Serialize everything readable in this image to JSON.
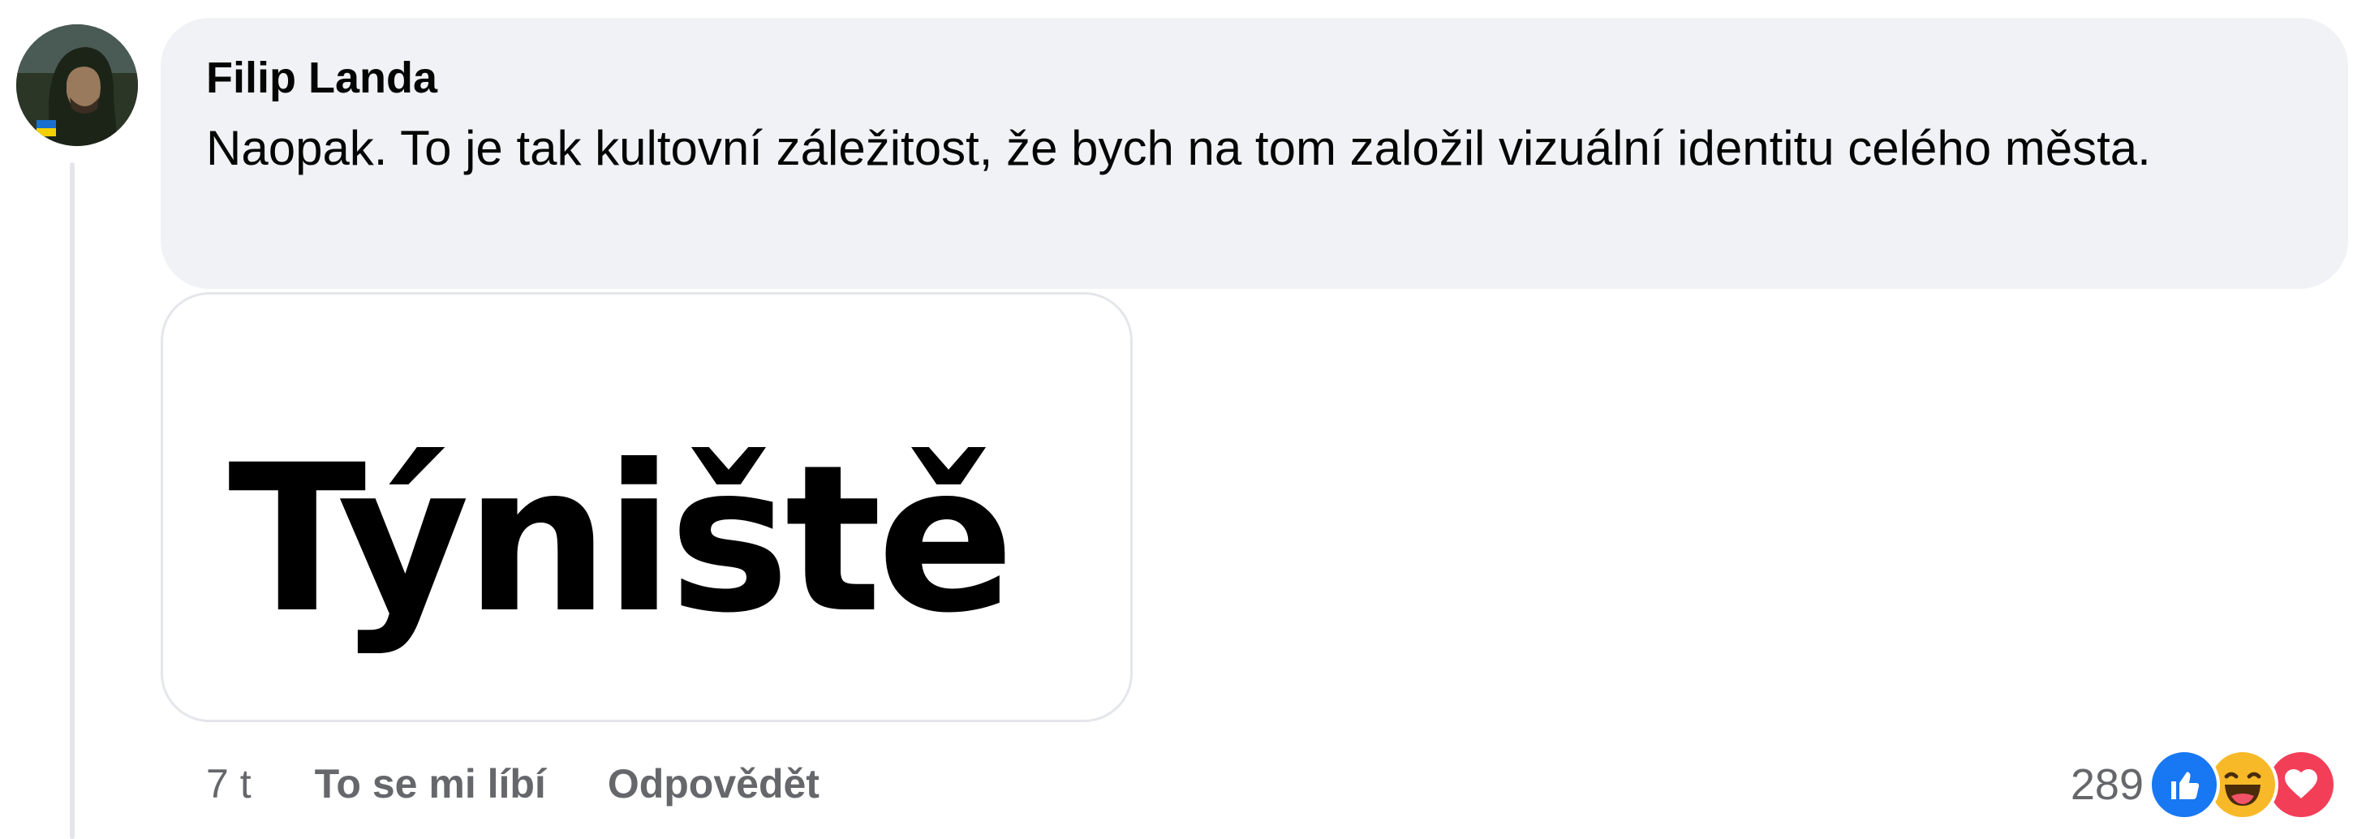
{
  "comment": {
    "author": "Filip Landa",
    "text": "Naopak. To je tak kultovní záležitost, že bych na tom založil vizuální identitu celého města.",
    "attachment": {
      "logo_text": "Týniště"
    }
  },
  "actions": {
    "time": "7 t",
    "like_label": "To se mi líbí",
    "reply_label": "Odpovědět"
  },
  "reactions": {
    "count": "289",
    "icons": [
      "like-icon",
      "haha-icon",
      "love-icon"
    ],
    "colors": {
      "like": "#1877f2",
      "haha": "#f7b928",
      "love": "#f33e58"
    }
  },
  "colors": {
    "bubble": "#f0f2f5",
    "secondary_text": "#65676b",
    "primary_text": "#050505"
  }
}
